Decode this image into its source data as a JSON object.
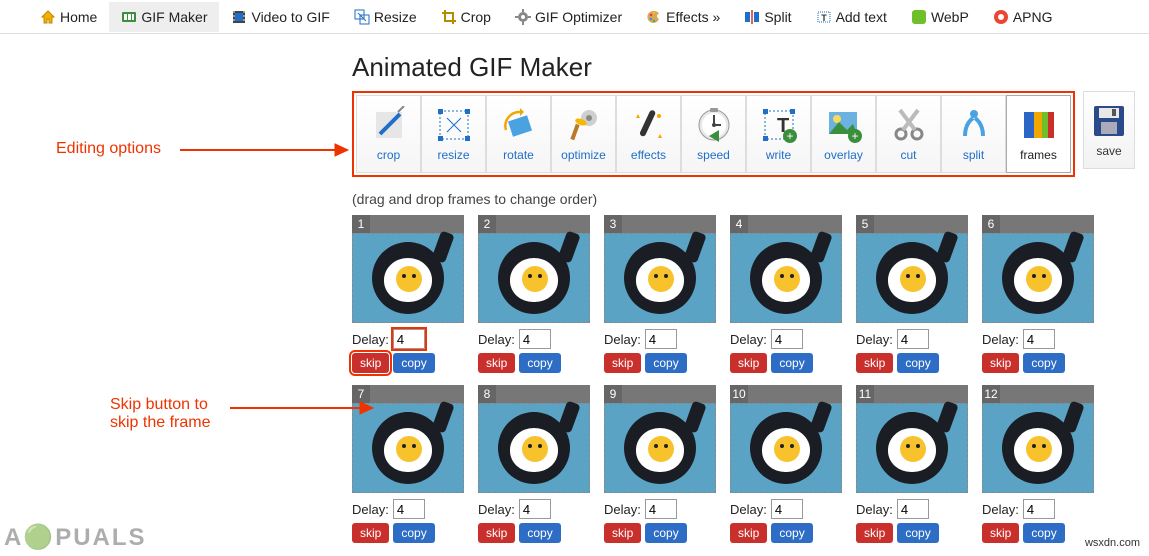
{
  "nav": {
    "home": "Home",
    "gifmaker": "GIF Maker",
    "video": "Video to GIF",
    "resize": "Resize",
    "crop": "Crop",
    "optimizer": "GIF Optimizer",
    "effects": "Effects »",
    "split": "Split",
    "addtext": "Add text",
    "webp": "WebP",
    "apng": "APNG"
  },
  "title": "Animated GIF Maker",
  "tools": {
    "crop": "crop",
    "resize": "resize",
    "rotate": "rotate",
    "optimize": "optimize",
    "effects": "effects",
    "speed": "speed",
    "write": "write",
    "overlay": "overlay",
    "cut": "cut",
    "split": "split",
    "frames": "frames"
  },
  "save_label": "save",
  "drag_hint": "(drag and drop frames to change order)",
  "delay_label": "Delay:",
  "skip_label": "skip",
  "copy_label": "copy",
  "frames_top": [
    {
      "num": "1",
      "delay": "4"
    },
    {
      "num": "2",
      "delay": "4"
    },
    {
      "num": "3",
      "delay": "4"
    },
    {
      "num": "4",
      "delay": "4"
    },
    {
      "num": "5",
      "delay": "4"
    },
    {
      "num": "6",
      "delay": "4"
    }
  ],
  "frames_bottom": [
    {
      "num": "7",
      "delay": "4"
    },
    {
      "num": "8",
      "delay": "4"
    },
    {
      "num": "9",
      "delay": "4"
    },
    {
      "num": "10",
      "delay": "4"
    },
    {
      "num": "11",
      "delay": "4"
    },
    {
      "num": "12",
      "delay": "4"
    }
  ],
  "annotation1": "Editing options",
  "annotation2a": "Skip button to",
  "annotation2b": "skip the frame",
  "watermark_text": "A🟢PUALS",
  "credit": "wsxdn.com"
}
